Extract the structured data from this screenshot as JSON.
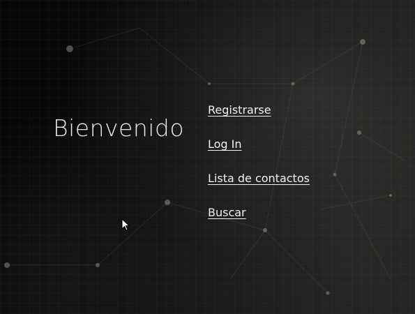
{
  "welcome_text": "Bienvenido",
  "nav": {
    "items": [
      {
        "label": "Registrarse"
      },
      {
        "label": "Log In"
      },
      {
        "label": "Lista de contactos"
      },
      {
        "label": "Buscar"
      }
    ]
  },
  "colors": {
    "background": "#0b0b0b",
    "text": "#f2f2f2"
  }
}
